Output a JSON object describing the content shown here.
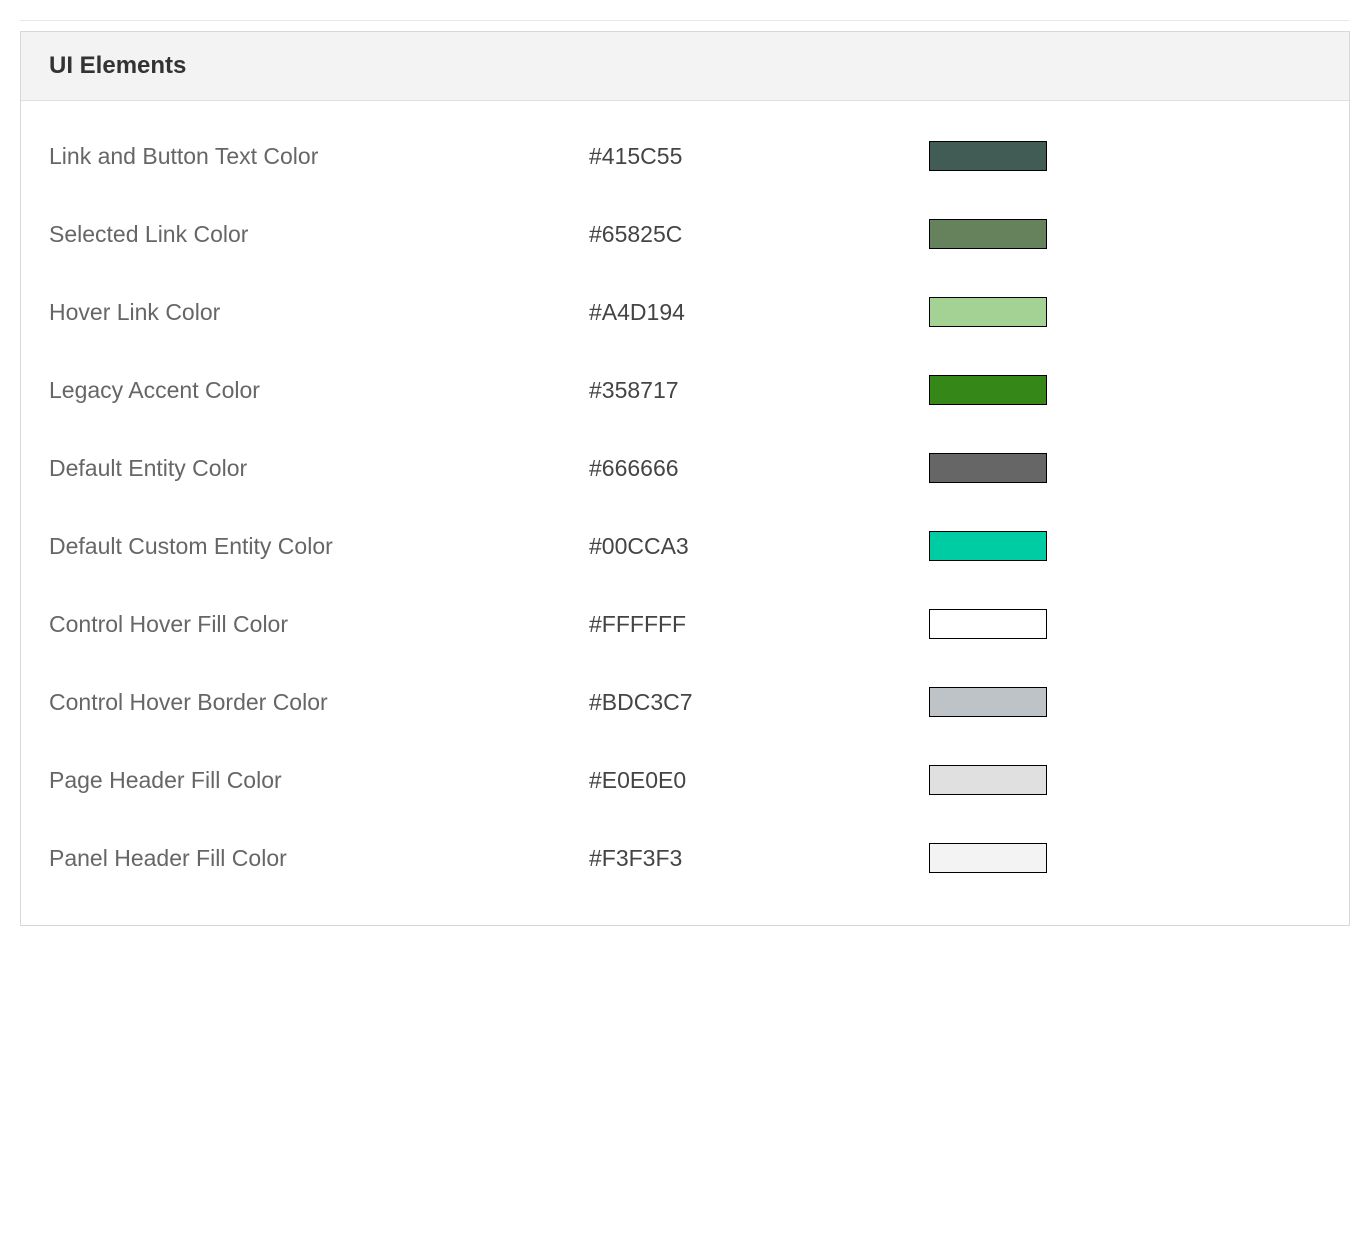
{
  "panel": {
    "title": "UI Elements",
    "rows": [
      {
        "label": "Link and Button Text Color",
        "value": "#415C55",
        "swatch": "#415C55"
      },
      {
        "label": "Selected Link Color",
        "value": "#65825C",
        "swatch": "#65825C"
      },
      {
        "label": "Hover Link Color",
        "value": "#A4D194",
        "swatch": "#A4D194"
      },
      {
        "label": "Legacy Accent Color",
        "value": "#358717",
        "swatch": "#358717"
      },
      {
        "label": "Default Entity Color",
        "value": "#666666",
        "swatch": "#666666"
      },
      {
        "label": "Default Custom Entity Color",
        "value": "#00CCA3",
        "swatch": "#00CCA3"
      },
      {
        "label": "Control Hover Fill Color",
        "value": "#FFFFFF",
        "swatch": "#FFFFFF"
      },
      {
        "label": "Control Hover Border Color",
        "value": "#BDC3C7",
        "swatch": "#BDC3C7"
      },
      {
        "label": "Page Header Fill Color",
        "value": "#E0E0E0",
        "swatch": "#E0E0E0"
      },
      {
        "label": "Panel Header Fill Color",
        "value": "#F3F3F3",
        "swatch": "#F3F3F3"
      }
    ]
  }
}
